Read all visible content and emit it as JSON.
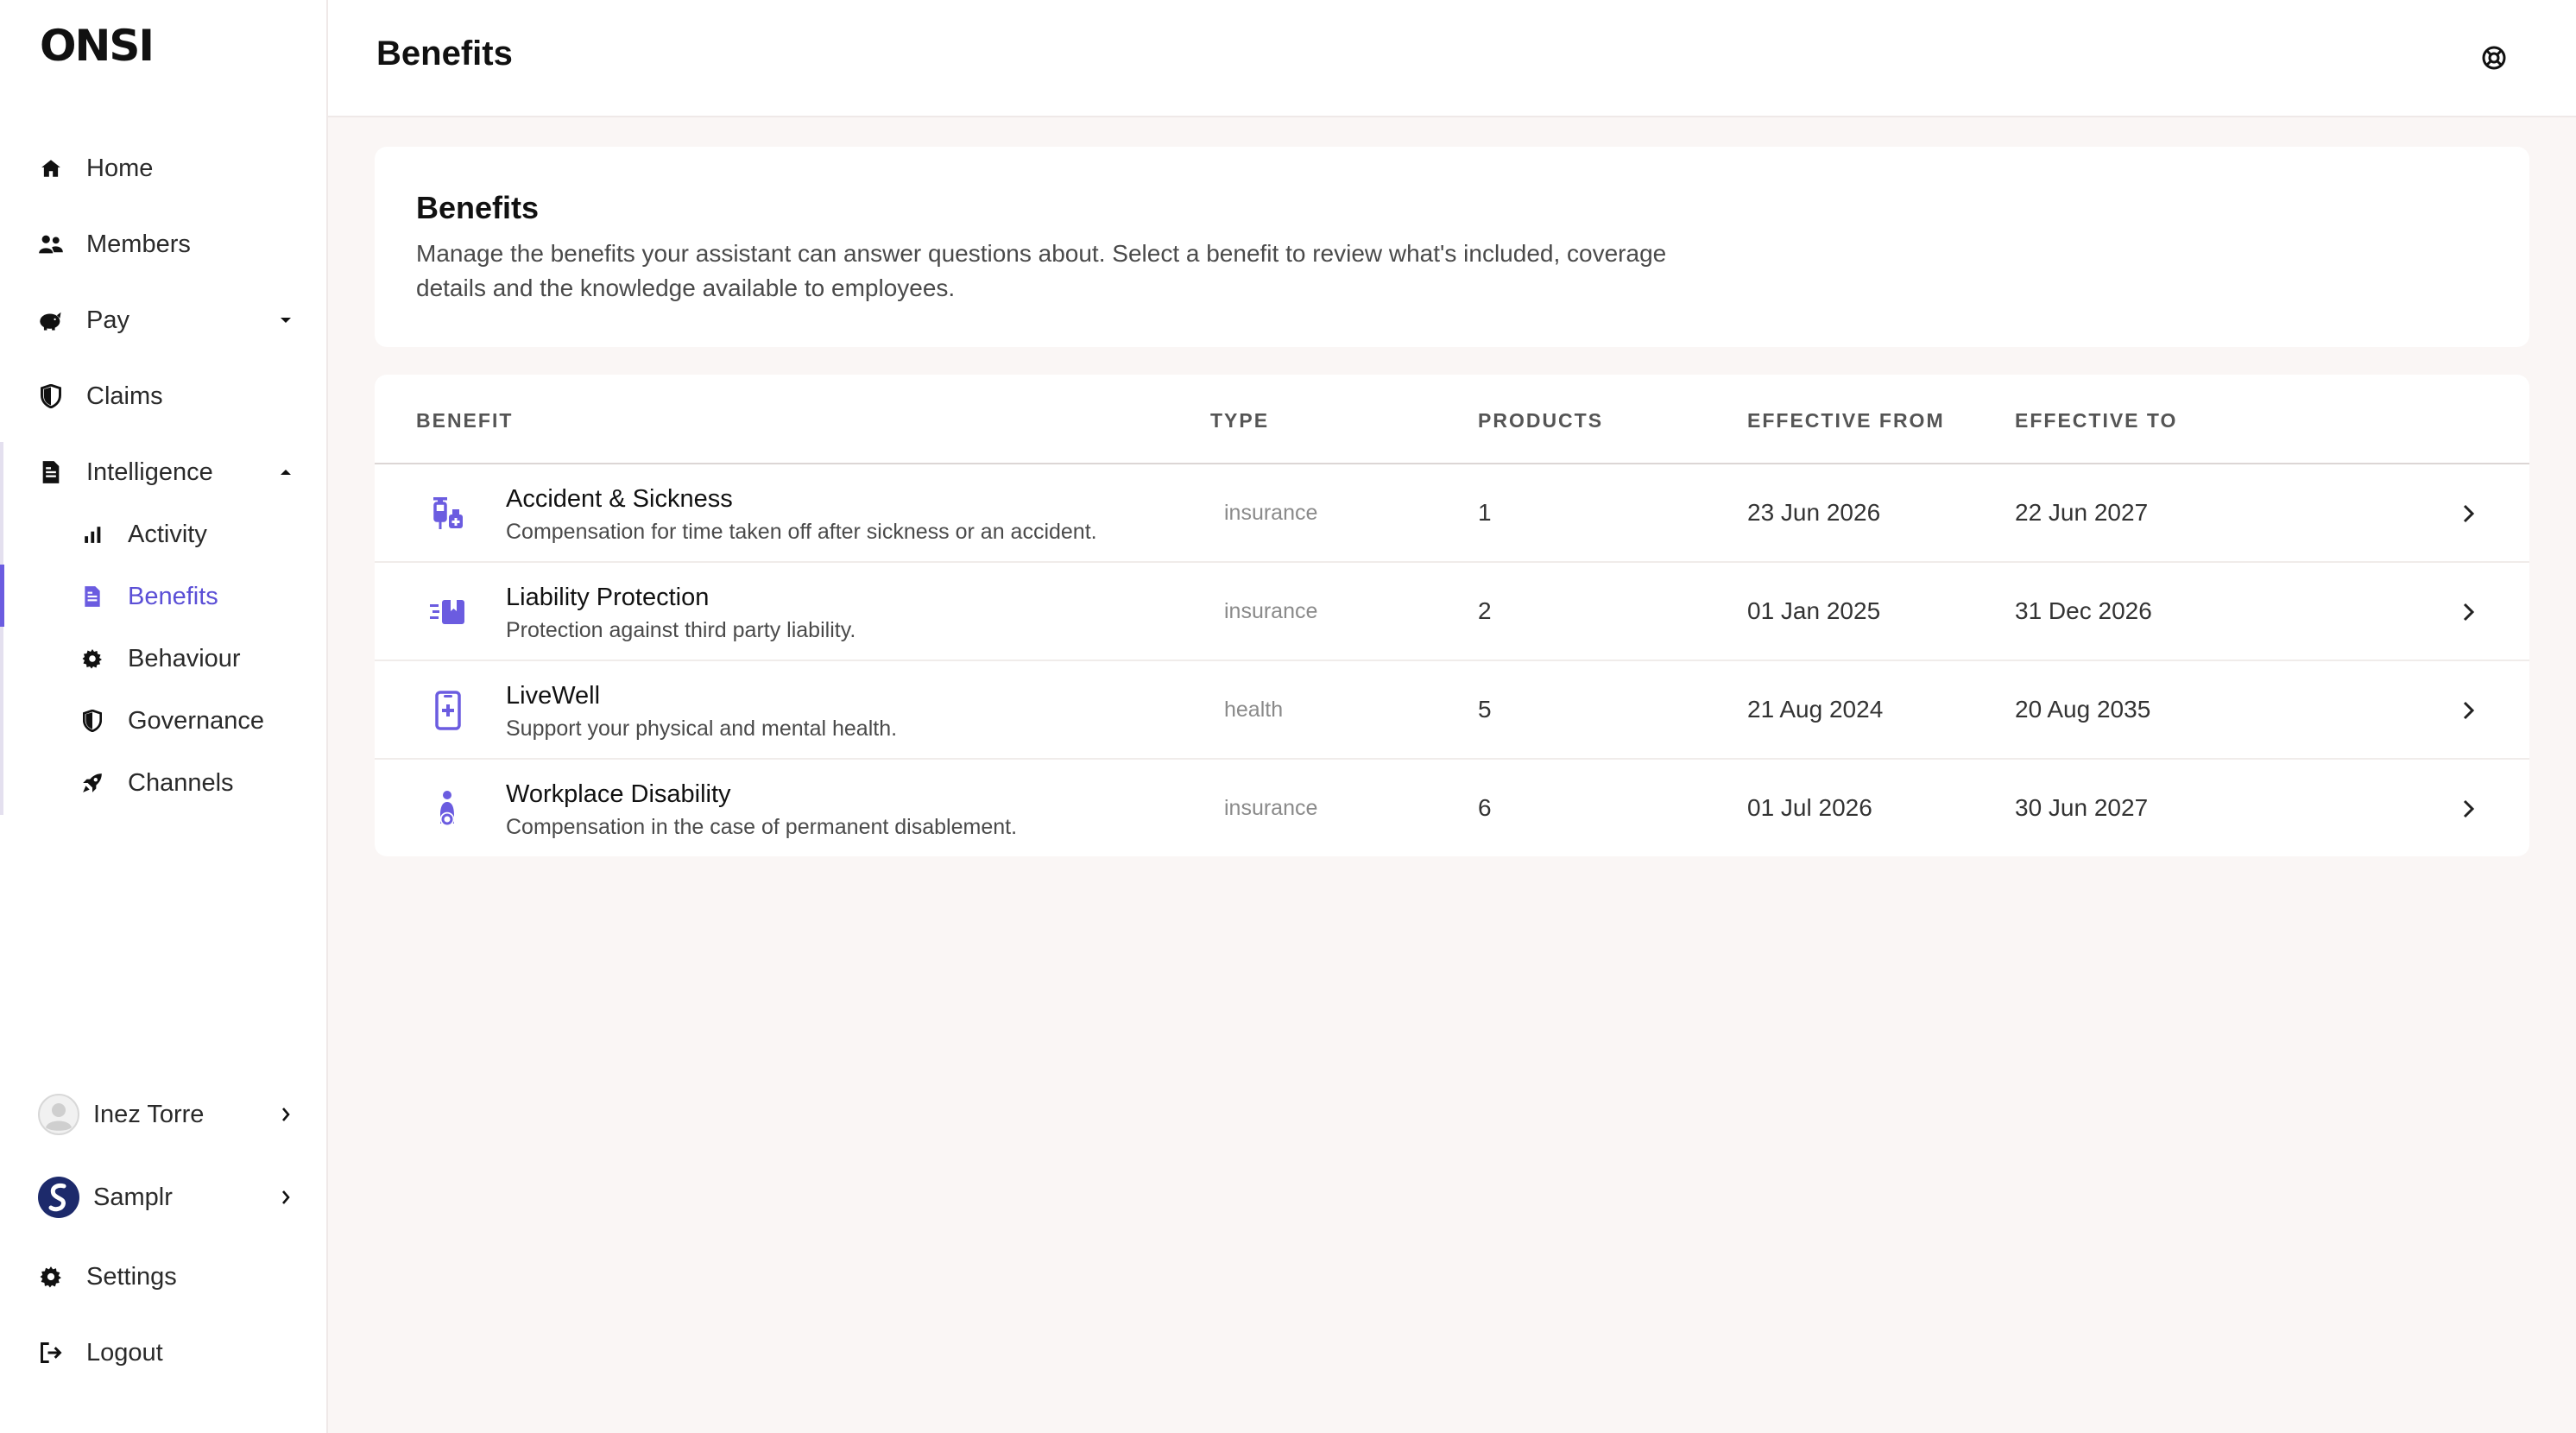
{
  "app": {
    "logo": "ONSI"
  },
  "sidebar": {
    "items": [
      {
        "label": "Home",
        "icon": "home-icon"
      },
      {
        "label": "Members",
        "icon": "members-icon"
      },
      {
        "label": "Pay",
        "icon": "piggy-bank-icon"
      },
      {
        "label": "Claims",
        "icon": "shield-icon"
      },
      {
        "label": "Intelligence",
        "icon": "document-icon"
      }
    ],
    "sub_items": [
      {
        "label": "Activity",
        "icon": "bar-chart-icon"
      },
      {
        "label": "Benefits",
        "icon": "document-icon"
      },
      {
        "label": "Behaviour",
        "icon": "gear-icon"
      },
      {
        "label": "Governance",
        "icon": "shield-icon"
      },
      {
        "label": "Channels",
        "icon": "rocket-icon"
      }
    ],
    "user": {
      "name": "Inez Torre"
    },
    "org": {
      "name": "Samplr"
    },
    "settings_label": "Settings",
    "logout_label": "Logout"
  },
  "header": {
    "title": "Benefits"
  },
  "intro": {
    "title": "Benefits",
    "description": "Manage the benefits your assistant can answer questions about. Select a benefit to review what's included, coverage details and the knowledge available to employees."
  },
  "table": {
    "columns": [
      "BENEFIT",
      "TYPE",
      "PRODUCTS",
      "EFFECTIVE FROM",
      "EFFECTIVE TO"
    ],
    "rows": [
      {
        "name": "Accident & Sickness",
        "description": "Compensation for time taken off after sickness or an accident.",
        "type": "insurance",
        "products": "1",
        "from": "23 Jun 2026",
        "to": "22 Jun 2027",
        "icon": "syringe-icon"
      },
      {
        "name": "Liability Protection",
        "description": "Protection against third party liability.",
        "type": "insurance",
        "products": "2",
        "from": "01 Jan 2025",
        "to": "31 Dec 2026",
        "icon": "fast-card-icon"
      },
      {
        "name": "LiveWell",
        "description": "Support your physical and mental health.",
        "type": "health",
        "products": "5",
        "from": "21 Aug 2024",
        "to": "20 Aug 2035",
        "icon": "phone-medical-icon"
      },
      {
        "name": "Workplace Disability",
        "description": "Compensation in the case of permanent disablement.",
        "type": "insurance",
        "products": "6",
        "from": "01 Jul 2026",
        "to": "30 Jun 2027",
        "icon": "wheelchair-person-icon"
      }
    ]
  },
  "colors": {
    "accent": "#5b4fd6",
    "icon_purple": "#6b5ce0",
    "background": "#faf6f5"
  }
}
